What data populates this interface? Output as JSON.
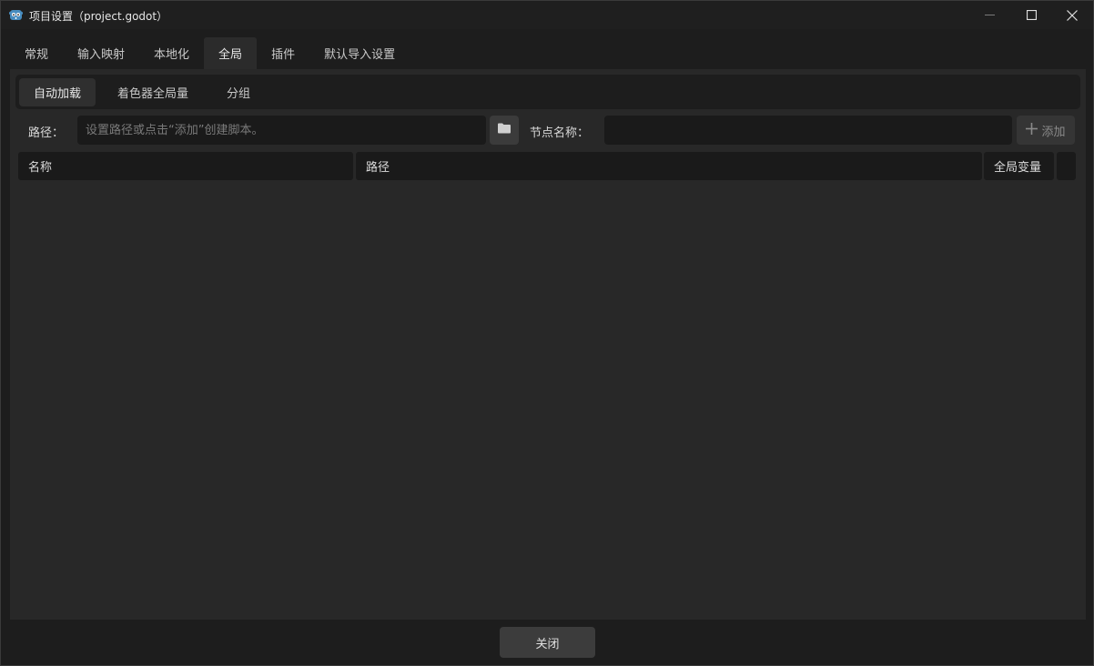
{
  "window": {
    "title": "项目设置（project.godot）"
  },
  "icons": {
    "app": "godot-icon",
    "minimize": "minimize-icon",
    "maximize": "maximize-icon",
    "close": "close-icon",
    "folder": "folder-icon",
    "add": "plus-icon"
  },
  "main_tabs": [
    {
      "label": "常规"
    },
    {
      "label": "输入映射"
    },
    {
      "label": "本地化"
    },
    {
      "label": "全局",
      "active": true
    },
    {
      "label": "插件"
    },
    {
      "label": "默认导入设置"
    }
  ],
  "sub_tabs": [
    {
      "label": "自动加载",
      "active": true
    },
    {
      "label": "着色器全局量"
    },
    {
      "label": "分组"
    }
  ],
  "form": {
    "path_label": "路径：",
    "path_placeholder": "设置路径或点击“添加”创建脚本。",
    "path_value": "",
    "node_name_label": "节点名称：",
    "node_name_value": "",
    "add_label": "添加"
  },
  "table": {
    "columns": [
      "名称",
      "路径",
      "全局变量"
    ],
    "rows": []
  },
  "footer": {
    "close_label": "关闭"
  },
  "colors": {
    "accent": "#478cbf",
    "window_bg": "#1d1d1d",
    "panel_bg": "#282828"
  }
}
